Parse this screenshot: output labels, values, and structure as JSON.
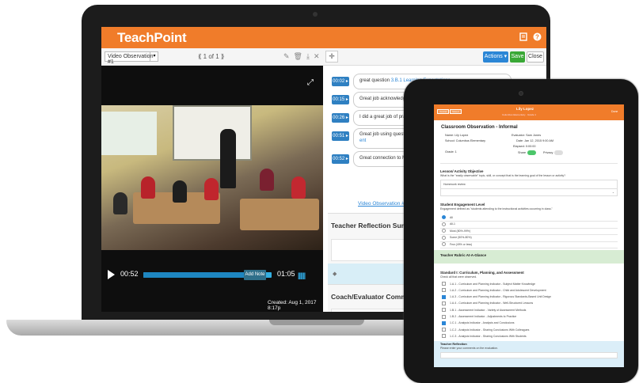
{
  "colors": {
    "brand_orange": "#f07c2a",
    "primary_blue": "#2b86d6",
    "save_green": "#3aa836",
    "video_progress": "#33aee0"
  },
  "laptop": {
    "brand": "TeachPoint",
    "header_icons": [
      "document-icon",
      "help-icon"
    ],
    "toolbar": {
      "video_select": "Video Observation #1",
      "pager": "⟪  1 of 1  ⟫",
      "actions_label": "Actions ▾",
      "save_label": "Save",
      "close_label": "Close"
    },
    "video": {
      "time_current": "00:52",
      "time_end": "01:05",
      "progress_fraction": 0.8,
      "add_note_label": "Add Note",
      "created": "Created: Aug 1, 2017 8:17p"
    },
    "notes": [
      {
        "ts": "00:02 ▸",
        "text": "great question ",
        "link": "3.B.1 Learning Expectations"
      },
      {
        "ts": "00:15 ▸",
        "text": "Great job acknowledging stu",
        "link": ""
      },
      {
        "ts": "00:26 ▸",
        "text": "I did a great job of praising st",
        "link": ""
      },
      {
        "ts": "00:51 ▸",
        "text": "Great job using questions to g",
        "link": "ent"
      },
      {
        "ts": "00:52 ▸",
        "text": "Great connection to Ms. Wigg",
        "link": ""
      }
    ],
    "video_link": "Video Observation #1 (video",
    "sections": {
      "teacher_reflection": "Teacher Reflection Summ",
      "coach_comments": "Coach/Evaluator Commen"
    }
  },
  "tablet": {
    "header_name": "Lily Lopez",
    "header_sub": "Columbus Elementary · Grade 1",
    "btn_left_1": "Cancel",
    "btn_left_2": "Saved",
    "btn_right": "Done",
    "title": "Classroom Observation - Informal",
    "fields": {
      "name": "Name: Lily Lopez",
      "school": "School: Columbus Elementary",
      "grade": "Grade:  1",
      "evaluator": "Evaluator: Sam Jones",
      "date": "Date: Jan 12, 2015 9:00 AM",
      "elapsed": "Elapsed: 0:00:00",
      "share": "Share",
      "privacy": "Privacy"
    },
    "lesson": {
      "title": "Lesson/ Activity Objective",
      "desc": "What is the \"easily observable\" topic, skill, or concept that is the learning goal of the lesson or activity?",
      "value": "Homework review"
    },
    "engagement": {
      "title": "Student Engagement Level",
      "desc": "Engagement defined as \"students attending to the instructional activities occurring in class.\"",
      "options": [
        "All",
        "All-1",
        "Most (80%-99%)",
        "Some (50%-80%)",
        "Few (49% or less)"
      ],
      "selected": 0
    },
    "rubric_title": "Teacher Rubric At-A-Glance",
    "standard": {
      "title": "Standard I:  Curriculum, Planning, and Assessment",
      "desc": "Check all that were observed.",
      "items": [
        {
          "label": "1.A.1 - Curriculum and Planning Indicator - Subject Matter Knowledge",
          "checked": false
        },
        {
          "label": "1.A.2 - Curriculum and Planning Indicator - Child and Adolescent Development",
          "checked": false
        },
        {
          "label": "1.A.3 - Curriculum and Planning Indicator - Rigorous Standards-Based Unit Design",
          "checked": true
        },
        {
          "label": "1.A.4 - Curriculum and Planning Indicator - Well-Structured Lessons",
          "checked": false
        },
        {
          "label": "1.B.1 - Assessment Indicator - Variety of Assessment Methods",
          "checked": false
        },
        {
          "label": "1.B.2 - Assessment Indicator - Adjustments to Practice",
          "checked": false
        },
        {
          "label": "1.C.1 - Analysis Indicator - Analysis and Conclusions",
          "checked": true
        },
        {
          "label": "1.C.2 - Analysis Indicator - Sharing Conclusions With Colleagues",
          "checked": false
        },
        {
          "label": "1.C.3 - Analysis Indicator - Sharing Conclusions With Students",
          "checked": false
        }
      ]
    },
    "reflection": {
      "title": "Teacher Reflection",
      "desc": "Please enter your comments on the evaluation."
    }
  }
}
